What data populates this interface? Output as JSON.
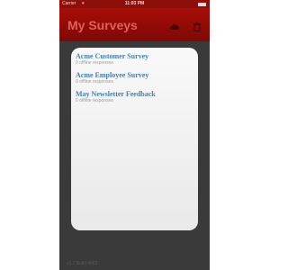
{
  "status_bar": {
    "carrier": "Carrier",
    "time": "11:03 PM"
  },
  "nav": {
    "title": "My Surveys",
    "icons": [
      "cloud-sync-icon",
      "trash-icon"
    ]
  },
  "surveys": [
    {
      "title": "Acme Customer Survey",
      "subtitle": "0 offline responses"
    },
    {
      "title": "Acme Employee Survey",
      "subtitle": "0 offline responses"
    },
    {
      "title": "May Newsletter Feedback",
      "subtitle": "0 offline responses"
    }
  ],
  "footer": {
    "text": "v1.7 Build 4062"
  },
  "colors": {
    "nav_background": "#8e0f0a",
    "nav_title": "#e0605a",
    "survey_title": "#3f7fb2",
    "body_background": "#3a3a3a"
  }
}
